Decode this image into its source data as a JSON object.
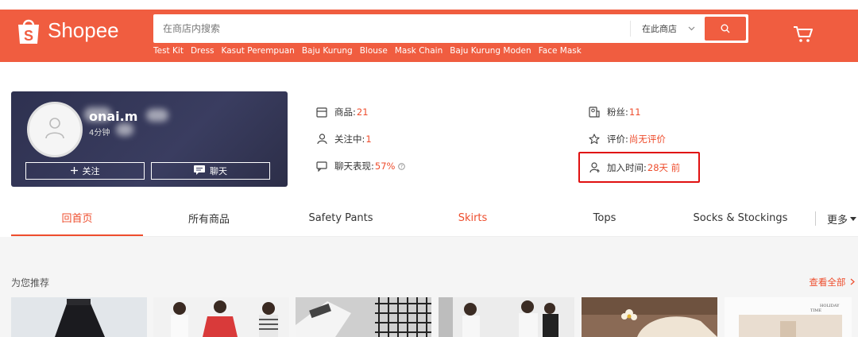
{
  "header": {
    "brand": "Shopee",
    "search_placeholder": "在商店内搜索",
    "scope_label": "在此商店",
    "hint_tags": [
      "Test Kit",
      "Dress",
      "Kasut Perempuan",
      "Baju Kurung",
      "Blouse",
      "Mask Chain",
      "Baju Kurung Moden",
      "Face Mask"
    ]
  },
  "shop": {
    "name": "onai.m",
    "active_status": "4分钟",
    "follow_label": "关注",
    "chat_label": "聊天"
  },
  "stats": {
    "products_label": "商品:",
    "products_value": "21",
    "following_label": "关注中:",
    "following_value": "1",
    "chat_perf_label": "聊天表现:",
    "chat_perf_value": "57%",
    "followers_label": "粉丝:",
    "followers_value": "11",
    "rating_label": "评价:",
    "rating_value": "尚无评价",
    "joined_label": "加入时间:",
    "joined_value": "28天 前"
  },
  "tabs": [
    {
      "label": "回首页"
    },
    {
      "label": "所有商品"
    },
    {
      "label": "Safety Pants"
    },
    {
      "label": "Skirts"
    },
    {
      "label": "Tops"
    },
    {
      "label": "Socks & Stockings"
    }
  ],
  "more_label": "更多",
  "recommendations": {
    "title": "为您推荐",
    "view_all": "查看全部"
  },
  "colors": {
    "brand": "#f05d40",
    "accent": "#ee4d2d",
    "shop_card": "#2e3150",
    "highlight_border": "#e01010"
  },
  "icons": [
    "shopee-bag-icon",
    "search-icon",
    "cart-icon",
    "avatar-icon",
    "plus-icon",
    "chat-icon",
    "store-icon",
    "user-icon",
    "chat-bubble-icon",
    "info-icon",
    "followers-icon",
    "star-icon",
    "joined-user-icon",
    "chevron-down-icon",
    "chevron-right-icon"
  ]
}
